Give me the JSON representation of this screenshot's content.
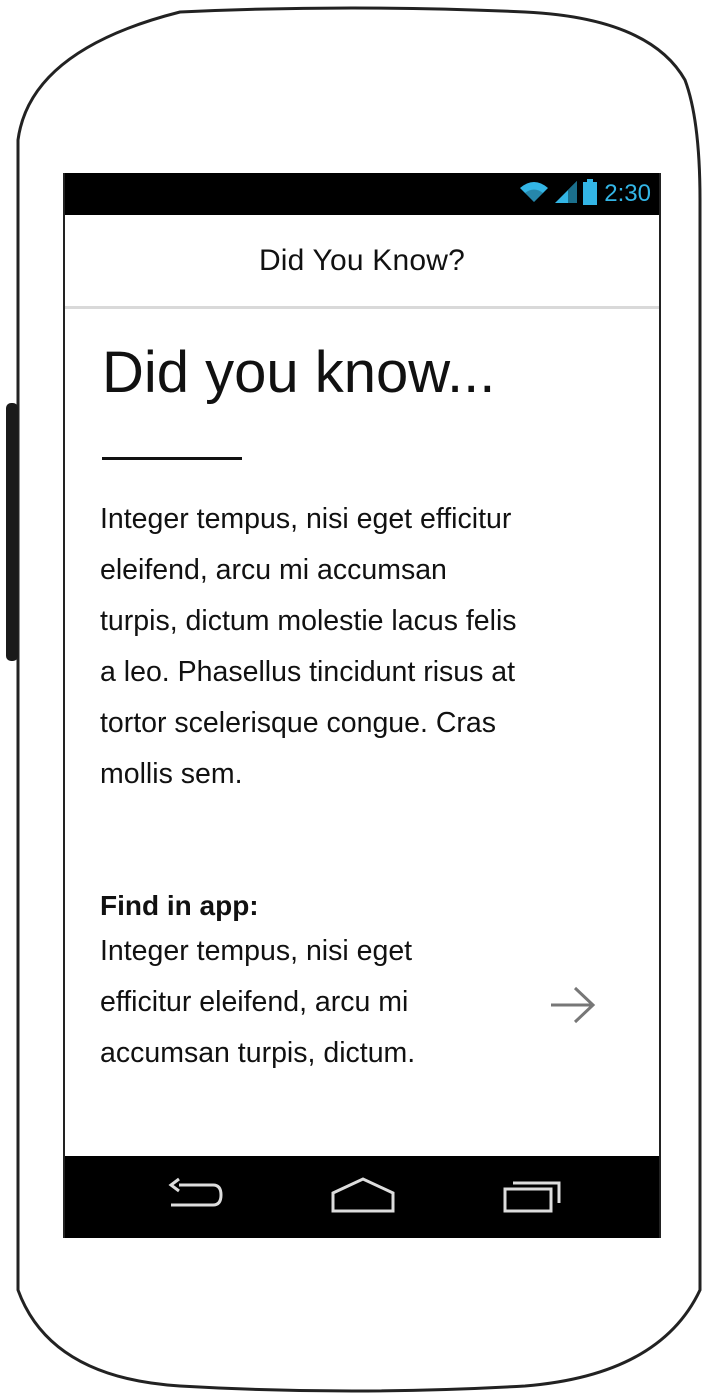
{
  "status_bar": {
    "time": "2:30",
    "icons": [
      "wifi-icon",
      "signal-icon",
      "battery-icon"
    ],
    "accent_color": "#33b5e5"
  },
  "action_bar": {
    "title": "Did You Know?"
  },
  "content": {
    "headline": "Did you know...",
    "body_lines": [
      "Integer tempus, nisi eget efficitur",
      "eleifend, arcu mi accumsan",
      "turpis, dictum molestie lacus felis",
      "a leo. Phasellus tincidunt risus at",
      "tortor scelerisque congue. Cras",
      "mollis sem."
    ],
    "find_label": "Find in app:",
    "find_lines": [
      "Integer tempus, nisi eget",
      "efficitur eleifend, arcu mi",
      "accumsan turpis, dictum."
    ],
    "arrow_icon": "arrow-right-icon"
  },
  "nav_bar": {
    "buttons": [
      "back-icon",
      "home-icon",
      "recent-apps-icon"
    ]
  }
}
